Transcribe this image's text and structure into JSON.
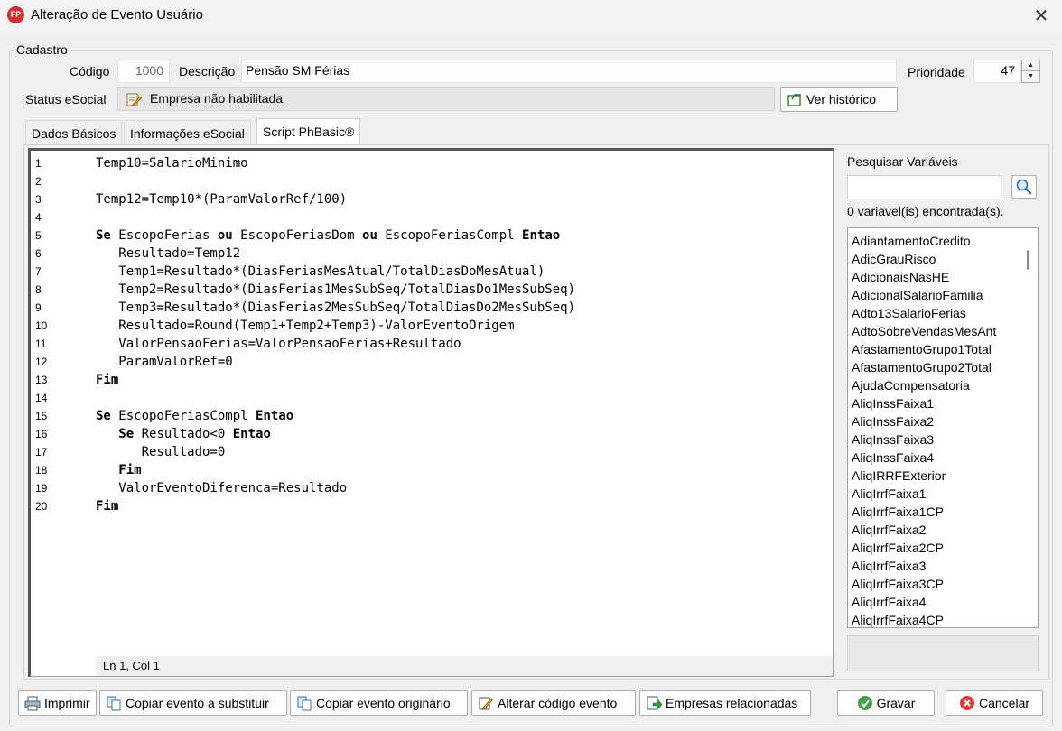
{
  "window": {
    "title": "Alteração de Evento Usuário",
    "app_badge": "FP",
    "close_glyph": "✕"
  },
  "cadastro": {
    "legend": "Cadastro",
    "codigo_label": "Código",
    "codigo_value": "1000",
    "descricao_label": "Descrição",
    "descricao_value": "Pensão SM Férias",
    "prioridade_label": "Prioridade",
    "prioridade_value": "47",
    "status_label": "Status eSocial",
    "status_value": "Empresa não habilitada",
    "ver_historico": "Ver histórico"
  },
  "tabs": [
    {
      "label": "Dados Básicos"
    },
    {
      "label": "Informações eSocial"
    },
    {
      "label": "Script PhBasic®"
    }
  ],
  "editor": {
    "status": "Ln 1, Col 1",
    "lines": [
      {
        "num": "1",
        "code": "Temp10=SalarioMinimo"
      },
      {
        "num": "2",
        "code": ""
      },
      {
        "num": "3",
        "code": "Temp12=Temp10*(ParamValorRef/100)"
      },
      {
        "num": "4",
        "code": ""
      },
      {
        "num": "5",
        "code": "Se EscopoFerias ou EscopoFeriasDom ou EscopoFeriasCompl Entao"
      },
      {
        "num": "6",
        "code": "   Resultado=Temp12"
      },
      {
        "num": "7",
        "code": "   Temp1=Resultado*(DiasFeriasMesAtual/TotalDiasDoMesAtual)"
      },
      {
        "num": "8",
        "code": "   Temp2=Resultado*(DiasFerias1MesSubSeq/TotalDiasDo1MesSubSeq)"
      },
      {
        "num": "9",
        "code": "   Temp3=Resultado*(DiasFerias2MesSubSeq/TotalDiasDo2MesSubSeq)"
      },
      {
        "num": "10",
        "code": "   Resultado=Round(Temp1+Temp2+Temp3)-ValorEventoOrigem"
      },
      {
        "num": "11",
        "code": "   ValorPensaoFerias=ValorPensaoFerias+Resultado"
      },
      {
        "num": "12",
        "code": "   ParamValorRef=0"
      },
      {
        "num": "13",
        "code": "Fim"
      },
      {
        "num": "14",
        "code": ""
      },
      {
        "num": "15",
        "code": "Se EscopoFeriasCompl Entao"
      },
      {
        "num": "16",
        "code": "   Se Resultado<0 Entao"
      },
      {
        "num": "17",
        "code": "      Resultado=0"
      },
      {
        "num": "18",
        "code": "   Fim"
      },
      {
        "num": "19",
        "code": "   ValorEventoDiferenca=Resultado"
      },
      {
        "num": "20",
        "code": "Fim"
      }
    ],
    "keywords": [
      "Se",
      "ou",
      "Entao",
      "Fim"
    ]
  },
  "variables": {
    "search_label": "Pesquisar Variáveis",
    "search_value": "",
    "found_text": "0 variavel(is) encontrada(s).",
    "items": [
      "AdiantamentoCredito",
      "AdicGrauRisco",
      "AdicionaisNasHE",
      "AdicionalSalarioFamilia",
      "Adto13SalarioFerias",
      "AdtoSobreVendasMesAnt",
      "AfastamentoGrupo1Total",
      "AfastamentoGrupo2Total",
      "AjudaCompensatoria",
      "AliqInssFaixa1",
      "AliqInssFaixa2",
      "AliqInssFaixa3",
      "AliqInssFaixa4",
      "AliqIRRFExterior",
      "AliqIrrfFaixa1",
      "AliqIrrfFaixa1CP",
      "AliqIrrfFaixa2",
      "AliqIrrfFaixa2CP",
      "AliqIrrfFaixa3",
      "AliqIrrfFaixa3CP",
      "AliqIrrfFaixa4",
      "AliqIrrfFaixa4CP"
    ]
  },
  "footer": {
    "imprimir": "Imprimir",
    "copiar_substituir": "Copiar evento a substituir",
    "copiar_originario": "Copiar evento originário",
    "alterar_codigo": "Alterar código evento",
    "empresas": "Empresas relacionadas",
    "gravar": "Gravar",
    "cancelar": "Cancelar"
  }
}
